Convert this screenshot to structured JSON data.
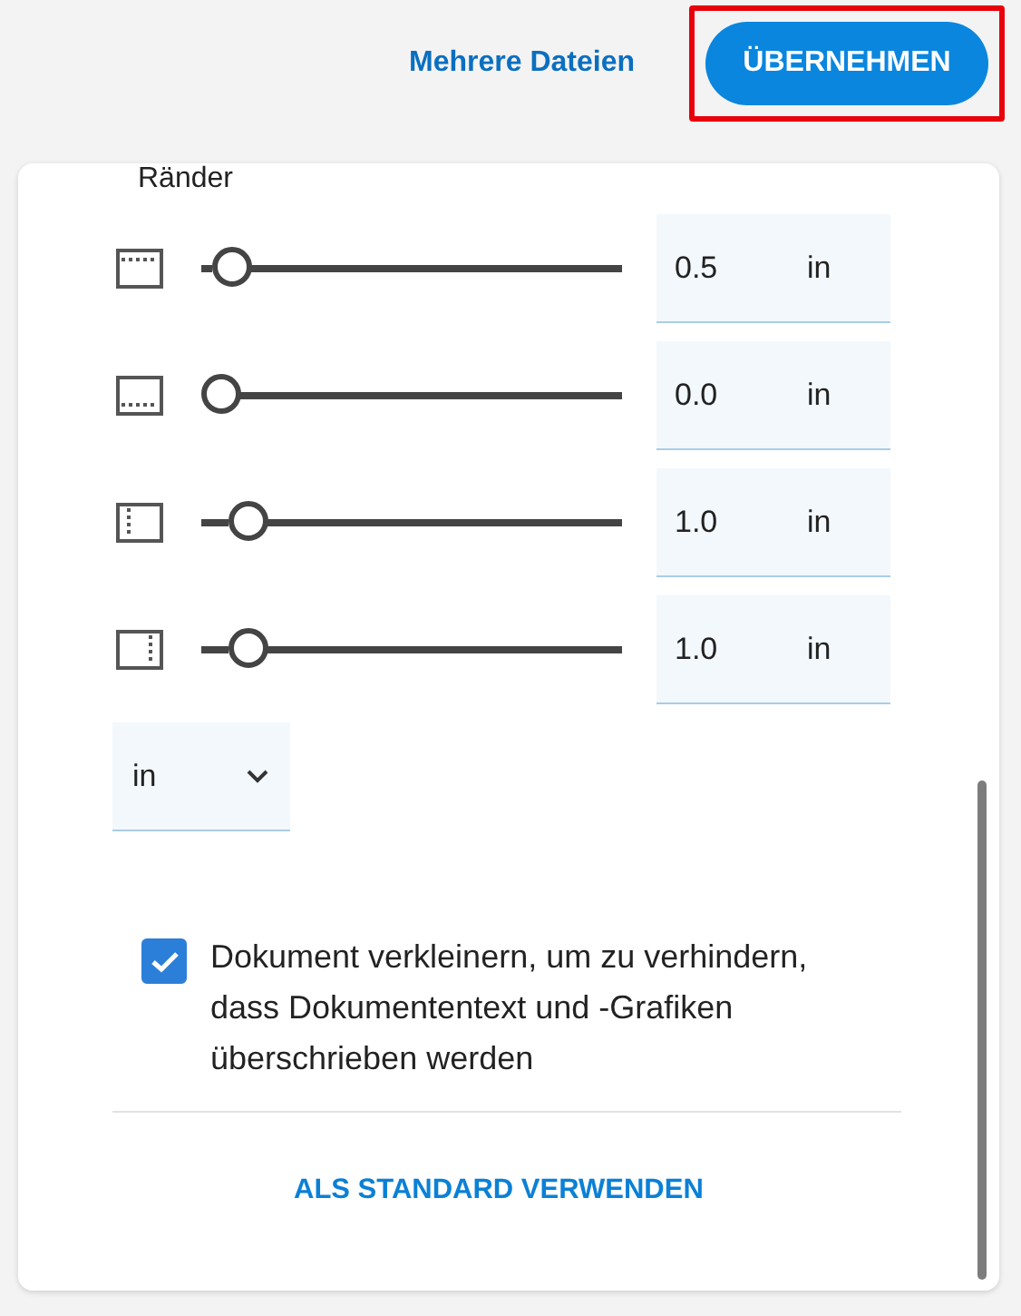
{
  "header": {
    "link": "Mehrere Dateien",
    "apply_button": {
      "label": "ÜBERNEHMEN",
      "highlighted": true
    }
  },
  "section_title": "Ränder",
  "margins": [
    {
      "kind": "top",
      "level": 0.03,
      "value": "0.5",
      "unit": "in"
    },
    {
      "kind": "bottom",
      "level": 0.0,
      "value": "0.0",
      "unit": "in"
    },
    {
      "kind": "left",
      "level": 0.07,
      "value": "1.0",
      "unit": "in"
    },
    {
      "kind": "right",
      "level": 0.07,
      "value": "1.0",
      "unit": "in"
    }
  ],
  "unit_select": {
    "value": "in"
  },
  "shrink_option": {
    "label": "Dokument verkleinern, um zu verhindern, dass Dokumententext und -Grafiken überschrieben werden",
    "checked": true
  },
  "default_button": "ALS STANDARD VERWENDEN"
}
